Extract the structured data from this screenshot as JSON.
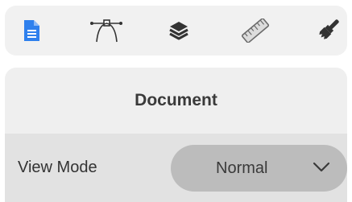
{
  "toolbar": {
    "tools": [
      {
        "icon": "document-icon",
        "active": true
      },
      {
        "icon": "bezier-curve-icon",
        "active": false
      },
      {
        "icon": "layers-icon",
        "active": false
      },
      {
        "icon": "ruler-icon",
        "active": false
      },
      {
        "icon": "paintbrush-icon",
        "active": false
      }
    ],
    "active_color": "#2f80ed",
    "icon_color": "#333333"
  },
  "section": {
    "title": "Document",
    "rows": [
      {
        "label": "View Mode",
        "value": "Normal"
      }
    ]
  }
}
